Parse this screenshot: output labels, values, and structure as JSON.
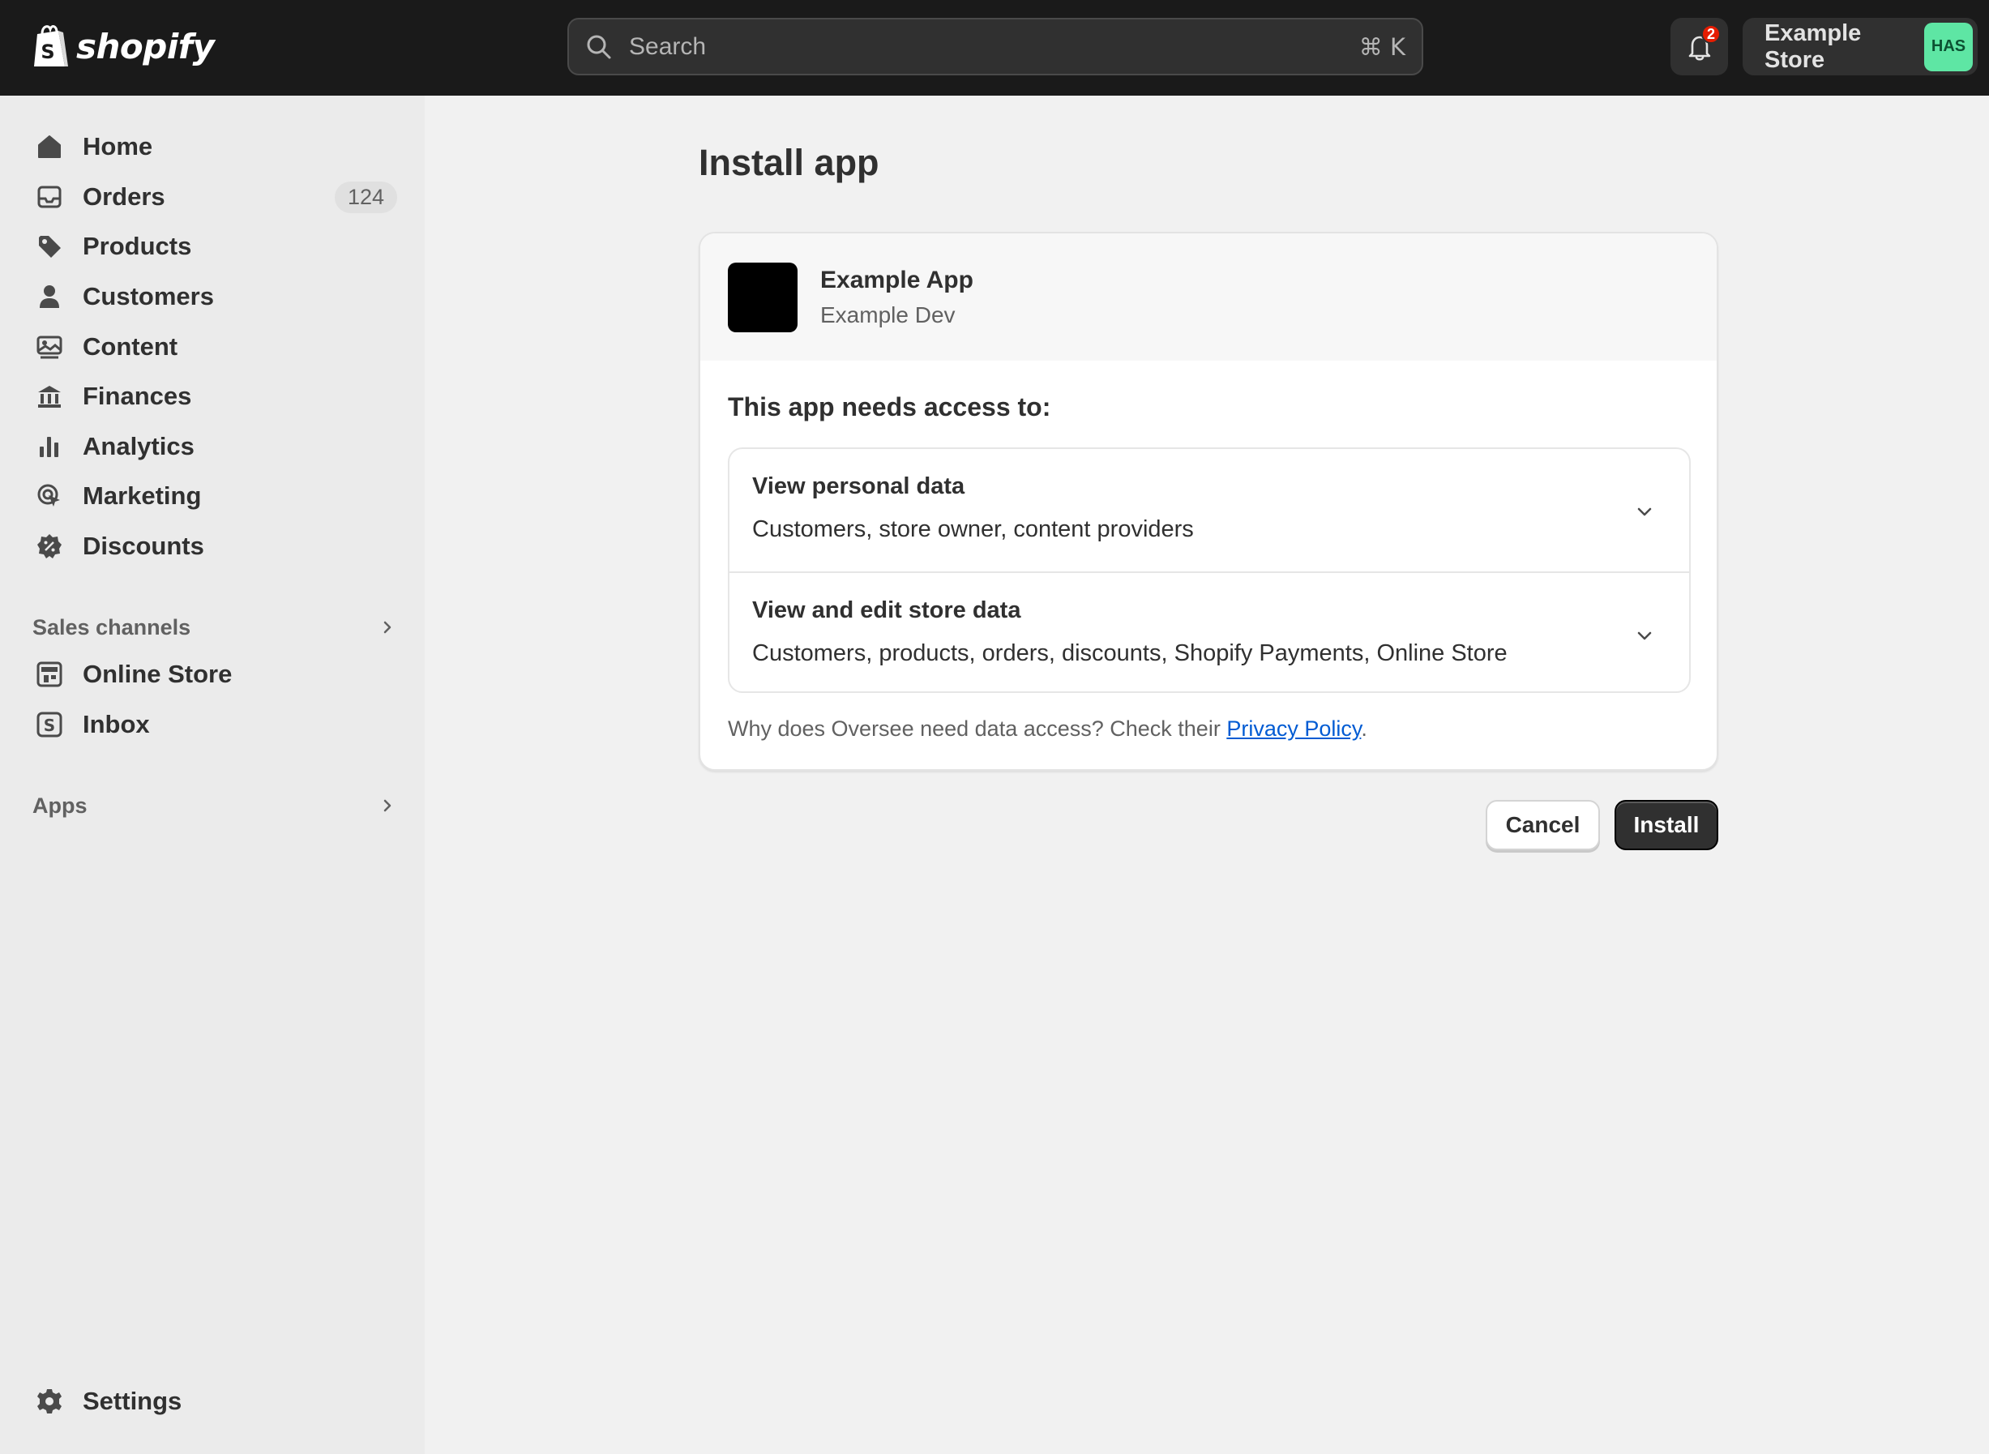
{
  "brand": {
    "name": "shopify"
  },
  "topbar": {
    "search_placeholder": "Search",
    "search_shortcut": "⌘ K",
    "notification_count": "2",
    "store_name": "Example Store",
    "avatar_initials": "HAS",
    "avatar_color": "#5ee6a4"
  },
  "sidebar": {
    "items": [
      {
        "label": "Home",
        "icon": "home-icon"
      },
      {
        "label": "Orders",
        "icon": "orders-icon",
        "count": "124"
      },
      {
        "label": "Products",
        "icon": "tag-icon"
      },
      {
        "label": "Customers",
        "icon": "person-icon"
      },
      {
        "label": "Content",
        "icon": "image-icon"
      },
      {
        "label": "Finances",
        "icon": "bank-icon"
      },
      {
        "label": "Analytics",
        "icon": "bar-chart-icon"
      },
      {
        "label": "Marketing",
        "icon": "target-icon"
      },
      {
        "label": "Discounts",
        "icon": "discount-icon"
      }
    ],
    "sales_channels_label": "Sales channels",
    "channels": [
      {
        "label": "Online Store",
        "icon": "store-icon"
      },
      {
        "label": "Inbox",
        "icon": "inbox-icon"
      }
    ],
    "apps_label": "Apps",
    "settings_label": "Settings"
  },
  "main": {
    "title": "Install app",
    "app": {
      "name": "Example App",
      "developer": "Example Dev"
    },
    "access_title": "This app needs access to:",
    "permissions": [
      {
        "title": "View personal data",
        "description": "Customers, store owner, content providers"
      },
      {
        "title": "View and edit store data",
        "description": "Customers, products, orders, discounts, Shopify Payments, Online Store"
      }
    ],
    "privacy_text": "Why does Oversee need data access? Check their ",
    "privacy_link": "Privacy Policy",
    "privacy_end": ".",
    "cancel_label": "Cancel",
    "install_label": "Install"
  }
}
